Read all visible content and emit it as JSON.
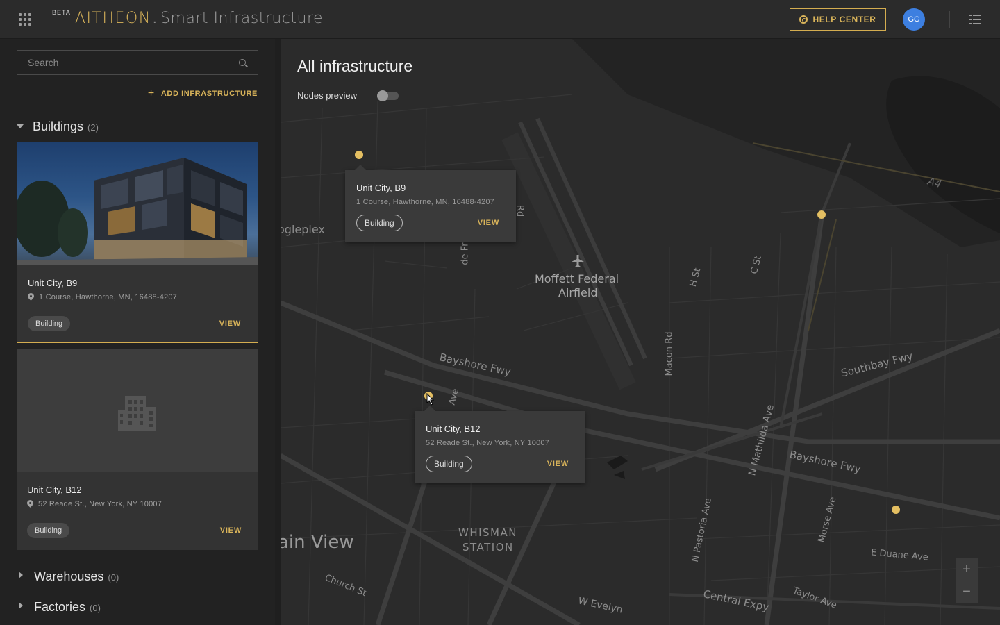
{
  "header": {
    "beta": "BETA",
    "logo": "AITHEON",
    "separator": ".",
    "product": "Smart Infrastructure",
    "help_label": "HELP CENTER",
    "avatar_initials": "GG"
  },
  "sidebar": {
    "search_placeholder": "Search",
    "add_label": "ADD INFRASTRUCTURE",
    "buildings": {
      "title": "Buildings",
      "count": "(2)",
      "items": [
        {
          "name": "Unit City, B9",
          "address": "1 Course, Hawthorne, MN, 16488-4207",
          "tag": "Building",
          "view": "VIEW"
        },
        {
          "name": "Unit City, B12",
          "address": "52 Reade St., New York, NY 10007",
          "tag": "Building",
          "view": "VIEW"
        }
      ]
    },
    "warehouses": {
      "title": "Warehouses",
      "count": "(0)"
    },
    "factories": {
      "title": "Factories",
      "count": "(0)"
    }
  },
  "map": {
    "title": "All infrastructure",
    "nodes_label": "Nodes preview",
    "nodes_enabled": false,
    "labels": {
      "googleplex": "ogleplex",
      "moffett": "Moffett Federal",
      "airfield": "Airfield",
      "bayshore1": "Bayshore Fwy",
      "bayshore2": "Bayshore Fwy",
      "southbay": "Southbay Fwy",
      "macon": "Macon Rd",
      "hst": "H St",
      "cst": "C St",
      "mathilda": "N Mathilda Ave",
      "pastoria": "N Pastoria Ave",
      "morse": "Morse Ave",
      "duane": "E Duane Ave",
      "whisman": "WHISMAN",
      "station": "STATION",
      "mtview": "ain View",
      "church": "Church St",
      "evelyn": "W Evelyn",
      "central": "Central Expy",
      "taylor": "Taylor Ave",
      "ave": "Ave",
      "defr": "de Fr",
      "rd": "Rd",
      "a4": "A4"
    },
    "popups": [
      {
        "name": "Unit City, B9",
        "address": "1 Course, Hawthorne, MN, 16488-4207",
        "tag": "Building",
        "view": "VIEW"
      },
      {
        "name": "Unit City, B12",
        "address": "52 Reade St., New York, NY 10007",
        "tag": "Building",
        "view": "VIEW"
      }
    ],
    "zoom_in": "+",
    "zoom_out": "−"
  },
  "colors": {
    "accent": "#d9b45a",
    "avatar": "#3d7fe0",
    "marker": "#e4bf62"
  }
}
